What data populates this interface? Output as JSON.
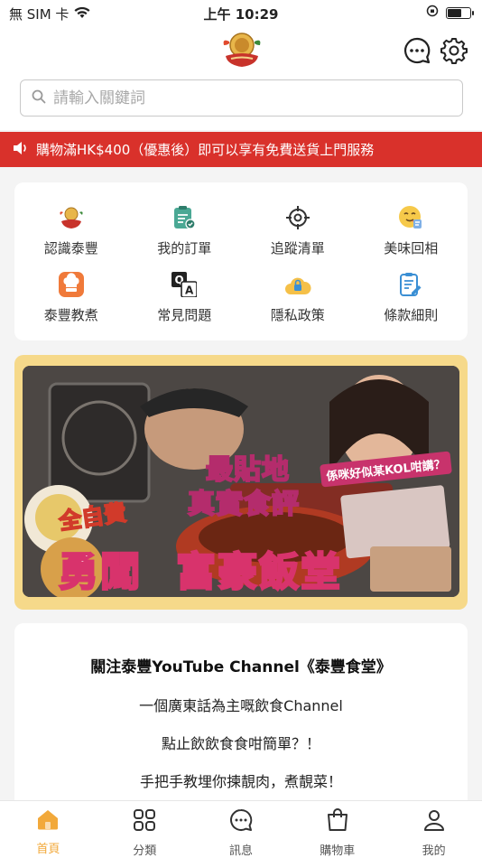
{
  "status_bar": {
    "carrier": "無 SIM 卡",
    "time": "上午 10:29"
  },
  "search": {
    "placeholder": "請輸入關鍵詞"
  },
  "notice": {
    "text": "購物滿HK$400（優惠後）即可以享有免費送貨上門服務"
  },
  "shortcuts": [
    {
      "label": "認識泰豐",
      "icon": "brand-logo-icon"
    },
    {
      "label": "我的訂單",
      "icon": "clipboard-check-icon"
    },
    {
      "label": "追蹤清單",
      "icon": "target-icon"
    },
    {
      "label": "美味回相",
      "icon": "yum-emoji-icon"
    },
    {
      "label": "泰豐教煮",
      "icon": "chef-hat-icon"
    },
    {
      "label": "常見問題",
      "icon": "qa-icon"
    },
    {
      "label": "隱私政策",
      "icon": "lock-cloud-icon"
    },
    {
      "label": "條款細則",
      "icon": "document-edit-icon"
    }
  ],
  "banner": {
    "line1": "最貼地",
    "line2": "真實食評",
    "tag_left": "全自費",
    "tag_right": "係咪好似某KOL咁講？",
    "title_left": "勇闖",
    "title_right": "富豪飯堂"
  },
  "youtube": {
    "title": "關注泰豐YouTube Channel《泰豐食堂》",
    "lines": [
      "一個廣東話為主嘅飲食Channel",
      "點止飲飲食食咁簡單？！",
      "手把手教埋你揀靚肉，煮靚菜！"
    ]
  },
  "tabs": [
    {
      "label": "首頁",
      "icon": "home-icon",
      "active": true
    },
    {
      "label": "分類",
      "icon": "category-grid-icon",
      "active": false
    },
    {
      "label": "訊息",
      "icon": "chat-icon",
      "active": false
    },
    {
      "label": "購物車",
      "icon": "shopping-bag-icon",
      "active": false
    },
    {
      "label": "我的",
      "icon": "user-icon",
      "active": false
    }
  ],
  "colors": {
    "accent": "#f2a93b",
    "notice_bg": "#d9312b",
    "banner_frame": "#f6d98a"
  }
}
